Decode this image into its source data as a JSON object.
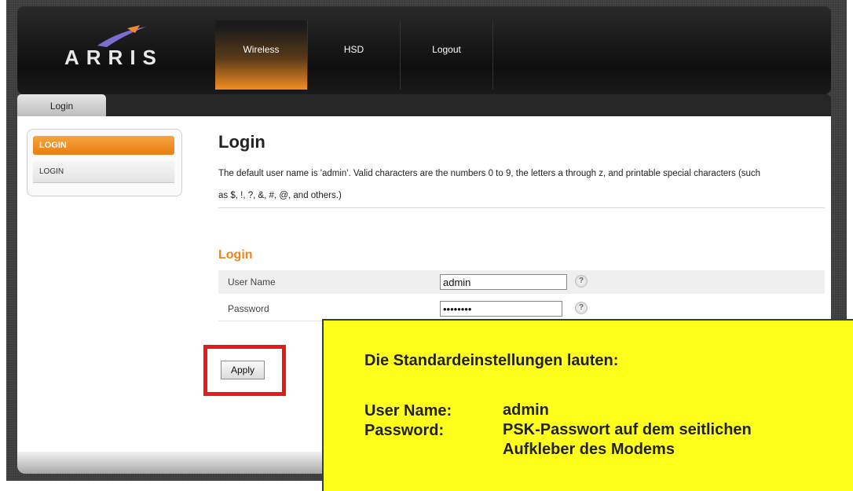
{
  "logo": {
    "text": "ARRIS"
  },
  "nav": {
    "items": [
      {
        "label": "Wireless",
        "active": true
      },
      {
        "label": "HSD",
        "active": false
      },
      {
        "label": "Logout",
        "active": false
      }
    ]
  },
  "tabs": {
    "active_tab": "Login"
  },
  "sidebar": {
    "active_label": "LOGIN",
    "item_label": "LOGIN"
  },
  "main": {
    "title": "Login",
    "description_line1": "The default user name is 'admin'. Valid characters are the numbers 0 to 9, the letters a through z, and printable special characters (such",
    "description_line2": "as $, !, ?, &, #, @, and others.)",
    "section_title": "Login",
    "fields": {
      "user_name_label": "User Name",
      "user_name_value": "admin",
      "password_label": "Password",
      "password_value": "••••••••"
    },
    "help_glyph": "?",
    "apply_label": "Apply"
  },
  "note": {
    "heading": "Die Standardeinstellungen lauten:",
    "user_label": "User Name:",
    "user_value": "admin",
    "password_label": "Password:",
    "password_value_line1": "PSK-Passwort auf dem seitlichen",
    "password_value_line2": "Aufkleber des Modems"
  },
  "colors": {
    "accent_orange": "#ea7e12",
    "highlight_red": "#e41b1b",
    "note_yellow": "#ffff1c"
  }
}
